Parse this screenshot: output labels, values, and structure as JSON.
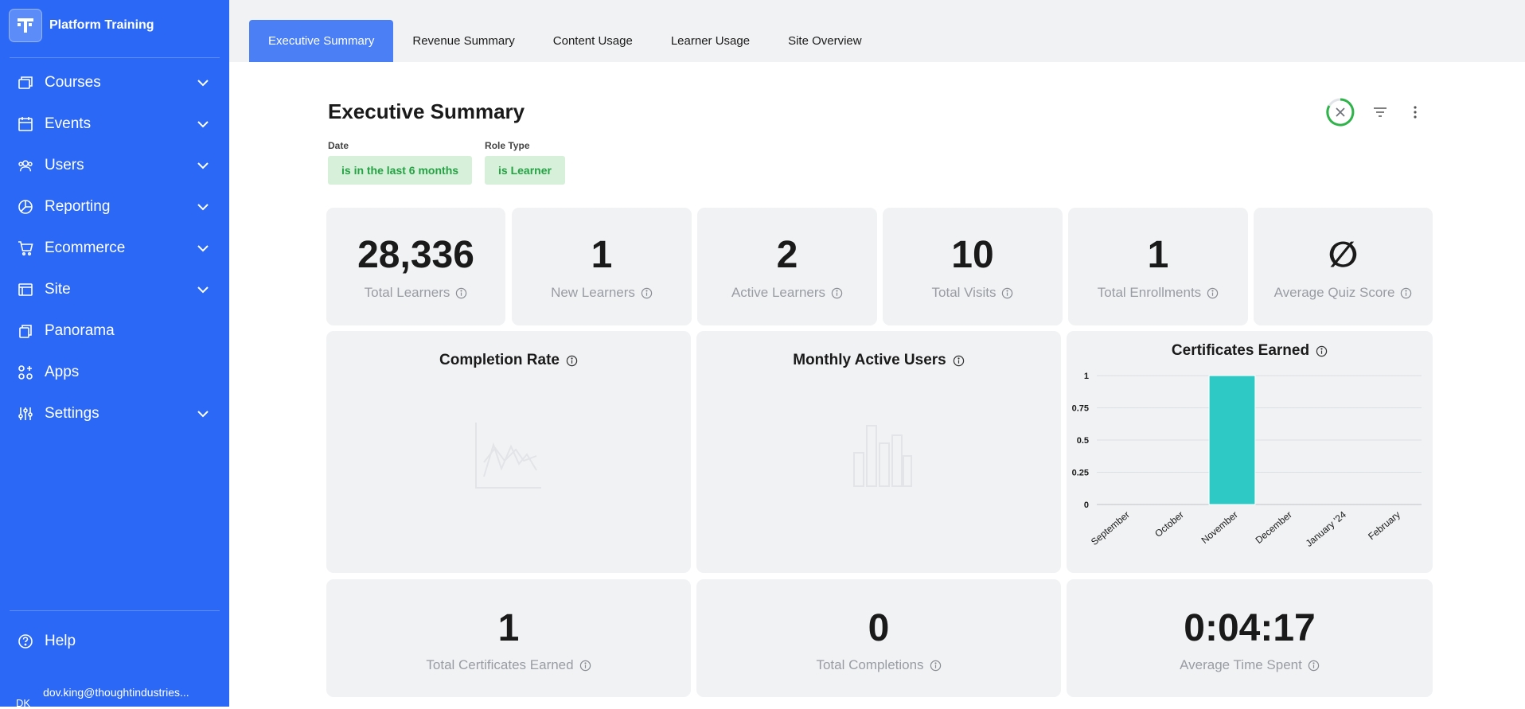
{
  "sidebar": {
    "brand_name": "Platform Training",
    "logo_letter": "T",
    "items": [
      {
        "label": "Courses",
        "icon": "courses-icon",
        "has_submenu": true
      },
      {
        "label": "Events",
        "icon": "calendar-icon",
        "has_submenu": true
      },
      {
        "label": "Users",
        "icon": "users-icon",
        "has_submenu": true
      },
      {
        "label": "Reporting",
        "icon": "pie-chart-icon",
        "has_submenu": true
      },
      {
        "label": "Ecommerce",
        "icon": "cart-icon",
        "has_submenu": true
      },
      {
        "label": "Site",
        "icon": "browser-icon",
        "has_submenu": true
      },
      {
        "label": "Panorama",
        "icon": "panorama-icon",
        "has_submenu": false
      },
      {
        "label": "Apps",
        "icon": "apps-icon",
        "has_submenu": false
      },
      {
        "label": "Settings",
        "icon": "sliders-icon",
        "has_submenu": true
      }
    ],
    "help_label": "Help",
    "user_initials": "DK",
    "user_email": "dov.king@thoughtindustries..."
  },
  "tabs": [
    {
      "label": "Executive Summary",
      "active": true
    },
    {
      "label": "Revenue Summary",
      "active": false
    },
    {
      "label": "Content Usage",
      "active": false
    },
    {
      "label": "Learner Usage",
      "active": false
    },
    {
      "label": "Site Overview",
      "active": false
    }
  ],
  "page_title": "Executive Summary",
  "filters": [
    {
      "label": "Date",
      "value": "is in the last 6 months"
    },
    {
      "label": "Role Type",
      "value": "is Learner"
    }
  ],
  "kpis_top": [
    {
      "value": "28,336",
      "label": "Total Learners"
    },
    {
      "value": "1",
      "label": "New Learners"
    },
    {
      "value": "2",
      "label": "Active Learners"
    },
    {
      "value": "10",
      "label": "Total Visits"
    },
    {
      "value": "1",
      "label": "Total Enrollments"
    },
    {
      "value": "∅",
      "label": "Average Quiz Score"
    }
  ],
  "charts": {
    "completion_rate_title": "Completion Rate",
    "monthly_active_users_title": "Monthly Active Users",
    "certificates_title": "Certificates Earned"
  },
  "kpis_bottom": [
    {
      "value": "1",
      "label": "Total Certificates Earned"
    },
    {
      "value": "0",
      "label": "Total Completions"
    },
    {
      "value": "0:04:17",
      "label": "Average Time Spent"
    }
  ],
  "colors": {
    "sidebar": "#2b68f6",
    "active_tab": "#4a7ff5",
    "chip_bg": "#d6f0d9",
    "chip_text": "#25a244",
    "bar": "#2ec9c4"
  },
  "chart_data": {
    "type": "bar",
    "title": "Certificates Earned",
    "categories": [
      "September",
      "October",
      "November",
      "December",
      "January '24",
      "February"
    ],
    "values": [
      0,
      0,
      1,
      0,
      0,
      0
    ],
    "ylim": [
      0,
      1
    ],
    "yticks": [
      "1",
      "0.75",
      "0.5",
      "0.25",
      "0"
    ],
    "grid": true
  }
}
